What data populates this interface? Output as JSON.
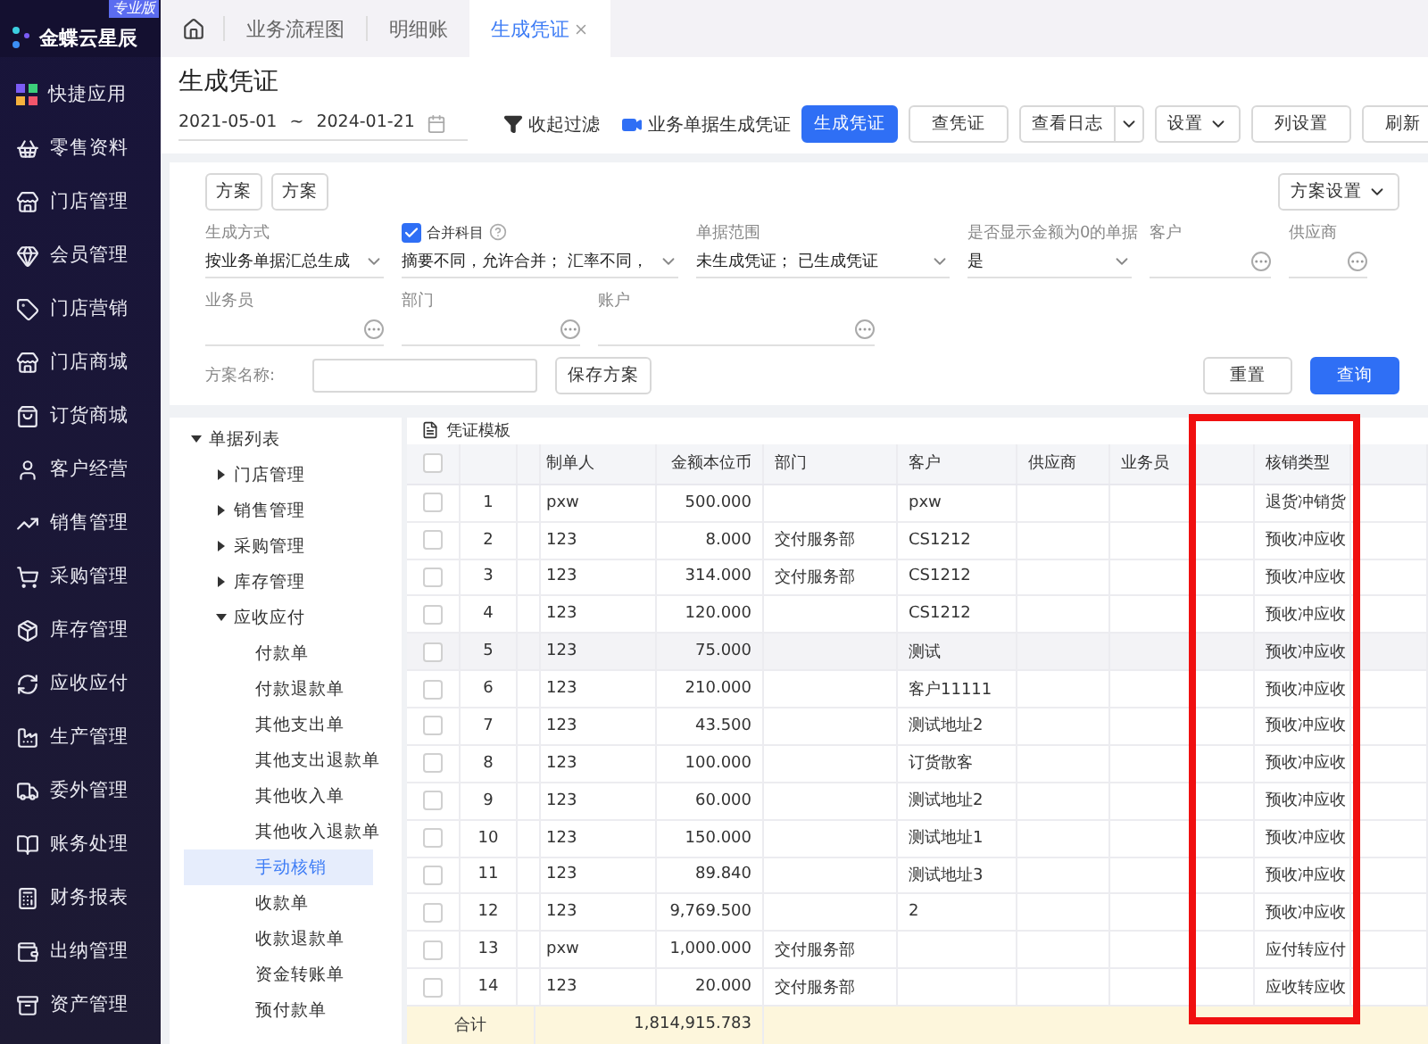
{
  "sidebar": {
    "logo": "金蝶云星辰",
    "edition": "专业版",
    "items": [
      {
        "label": "快捷应用"
      },
      {
        "label": "零售资料"
      },
      {
        "label": "门店管理"
      },
      {
        "label": "会员管理"
      },
      {
        "label": "门店营销"
      },
      {
        "label": "门店商城"
      },
      {
        "label": "订货商城"
      },
      {
        "label": "客户经营"
      },
      {
        "label": "销售管理"
      },
      {
        "label": "采购管理"
      },
      {
        "label": "库存管理"
      },
      {
        "label": "应收应付"
      },
      {
        "label": "生产管理"
      },
      {
        "label": "委外管理"
      },
      {
        "label": "账务处理"
      },
      {
        "label": "财务报表"
      },
      {
        "label": "出纳管理"
      },
      {
        "label": "资产管理"
      }
    ]
  },
  "tabs": [
    {
      "label": "业务流程图",
      "selected": false,
      "closable": false
    },
    {
      "label": "明细账",
      "selected": false,
      "closable": false
    },
    {
      "label": "生成凭证",
      "selected": true,
      "closable": true
    }
  ],
  "header": {
    "title": "生成凭证",
    "date_from": "2021-05-01",
    "date_separator": "~",
    "date_to": "2024-01-21",
    "collapse_filter": "收起过滤",
    "buttons": [
      {
        "label": "业务单据生成凭证",
        "kind": "video-link"
      },
      {
        "label": "生成凭证",
        "kind": "primary"
      },
      {
        "label": "查凭证",
        "kind": "default"
      },
      {
        "label": "查看日志",
        "kind": "split"
      },
      {
        "label": "设置",
        "kind": "dropdown"
      },
      {
        "label": "列设置",
        "kind": "default"
      },
      {
        "label": "刷新",
        "kind": "default"
      }
    ]
  },
  "filter": {
    "schemes": [
      "方案",
      "方案"
    ],
    "scheme_settings": "方案设置",
    "fields": [
      {
        "label": "生成方式",
        "value": "按业务单据汇总生成",
        "kind": "select"
      },
      {
        "label": "合并科目",
        "value": "摘要不同，允许合并；  汇率不同，",
        "kind": "check-select",
        "checked": true
      },
      {
        "label": "单据范围",
        "value": "未生成凭证；  已生成凭证",
        "kind": "select"
      },
      {
        "label": "是否显示金额为0的单据",
        "value": "是",
        "kind": "select"
      },
      {
        "label": "客户",
        "kind": "lookup"
      },
      {
        "label": "供应商",
        "kind": "lookup"
      },
      {
        "label": "业务员",
        "kind": "lookup"
      },
      {
        "label": "部门",
        "kind": "lookup"
      },
      {
        "label": "账户",
        "kind": "lookup"
      }
    ],
    "scheme_name_label": "方案名称:",
    "save_scheme": "保存方案",
    "reset": "重置",
    "query": "查询"
  },
  "tree": {
    "label": "单据列表",
    "expanded": true,
    "children": [
      {
        "label": "门店管理",
        "expanded": false,
        "selected": false
      },
      {
        "label": "销售管理",
        "expanded": false,
        "selected": false
      },
      {
        "label": "采购管理",
        "expanded": false,
        "selected": false
      },
      {
        "label": "库存管理",
        "expanded": false,
        "selected": false
      },
      {
        "label": "应收应付",
        "expanded": true,
        "selected": false,
        "children": [
          {
            "label": "付款单",
            "selected": false
          },
          {
            "label": "付款退款单",
            "selected": false
          },
          {
            "label": "其他支出单",
            "selected": false
          },
          {
            "label": "其他支出退款单",
            "selected": false
          },
          {
            "label": "其他收入单",
            "selected": false
          },
          {
            "label": "其他收入退款单",
            "selected": false
          },
          {
            "label": "手动核销",
            "selected": true
          },
          {
            "label": "收款单",
            "selected": false
          },
          {
            "label": "收款退款单",
            "selected": false
          },
          {
            "label": "资金转账单",
            "selected": false
          },
          {
            "label": "预付款单",
            "selected": false
          }
        ]
      }
    ]
  },
  "table": {
    "title": "凭证模板",
    "select_all_checked": false,
    "columns": [
      "制单人",
      "金额本位币",
      "部门",
      "客户",
      "供应商",
      "业务员",
      "核销类型"
    ],
    "rows": [
      {
        "no": "1",
        "cells": [
          "pxw",
          "500.000",
          "",
          "pxw",
          "",
          "",
          "退货冲销货"
        ],
        "checked": false,
        "selected": false
      },
      {
        "no": "2",
        "cells": [
          "123",
          "8.000",
          "交付服务部",
          "CS1212",
          "",
          "",
          "预收冲应收"
        ],
        "checked": false,
        "selected": false
      },
      {
        "no": "3",
        "cells": [
          "123",
          "314.000",
          "交付服务部",
          "CS1212",
          "",
          "",
          "预收冲应收"
        ],
        "checked": false,
        "selected": false
      },
      {
        "no": "4",
        "cells": [
          "123",
          "120.000",
          "",
          "CS1212",
          "",
          "",
          "预收冲应收"
        ],
        "checked": false,
        "selected": false
      },
      {
        "no": "5",
        "cells": [
          "123",
          "75.000",
          "",
          "测试",
          "",
          "",
          "预收冲应收"
        ],
        "checked": false,
        "selected": true
      },
      {
        "no": "6",
        "cells": [
          "123",
          "210.000",
          "",
          "客户11111",
          "",
          "",
          "预收冲应收"
        ],
        "checked": false,
        "selected": false
      },
      {
        "no": "7",
        "cells": [
          "123",
          "43.500",
          "",
          "测试地址2",
          "",
          "",
          "预收冲应收"
        ],
        "checked": false,
        "selected": false
      },
      {
        "no": "8",
        "cells": [
          "123",
          "100.000",
          "",
          "订货散客",
          "",
          "",
          "预收冲应收"
        ],
        "checked": false,
        "selected": false
      },
      {
        "no": "9",
        "cells": [
          "123",
          "60.000",
          "",
          "测试地址2",
          "",
          "",
          "预收冲应收"
        ],
        "checked": false,
        "selected": false
      },
      {
        "no": "10",
        "cells": [
          "123",
          "150.000",
          "",
          "测试地址1",
          "",
          "",
          "预收冲应收"
        ],
        "checked": false,
        "selected": false
      },
      {
        "no": "11",
        "cells": [
          "123",
          "89.840",
          "",
          "测试地址3",
          "",
          "",
          "预收冲应收"
        ],
        "checked": false,
        "selected": false
      },
      {
        "no": "12",
        "cells": [
          "123",
          "9,769.500",
          "",
          "2",
          "",
          "",
          "预收冲应收"
        ],
        "checked": false,
        "selected": false
      },
      {
        "no": "13",
        "cells": [
          "pxw",
          "1,000.000",
          "交付服务部",
          "",
          "",
          "",
          "应付转应付"
        ],
        "checked": false,
        "selected": false
      },
      {
        "no": "14",
        "cells": [
          "123",
          "20.000",
          "交付服务部",
          "",
          "",
          "",
          "应收转应收"
        ],
        "checked": false,
        "selected": false
      }
    ],
    "footer": {
      "label": "合计",
      "total": "1,814,915.783"
    },
    "annotation": {
      "kind": "rectangle"
    }
  }
}
